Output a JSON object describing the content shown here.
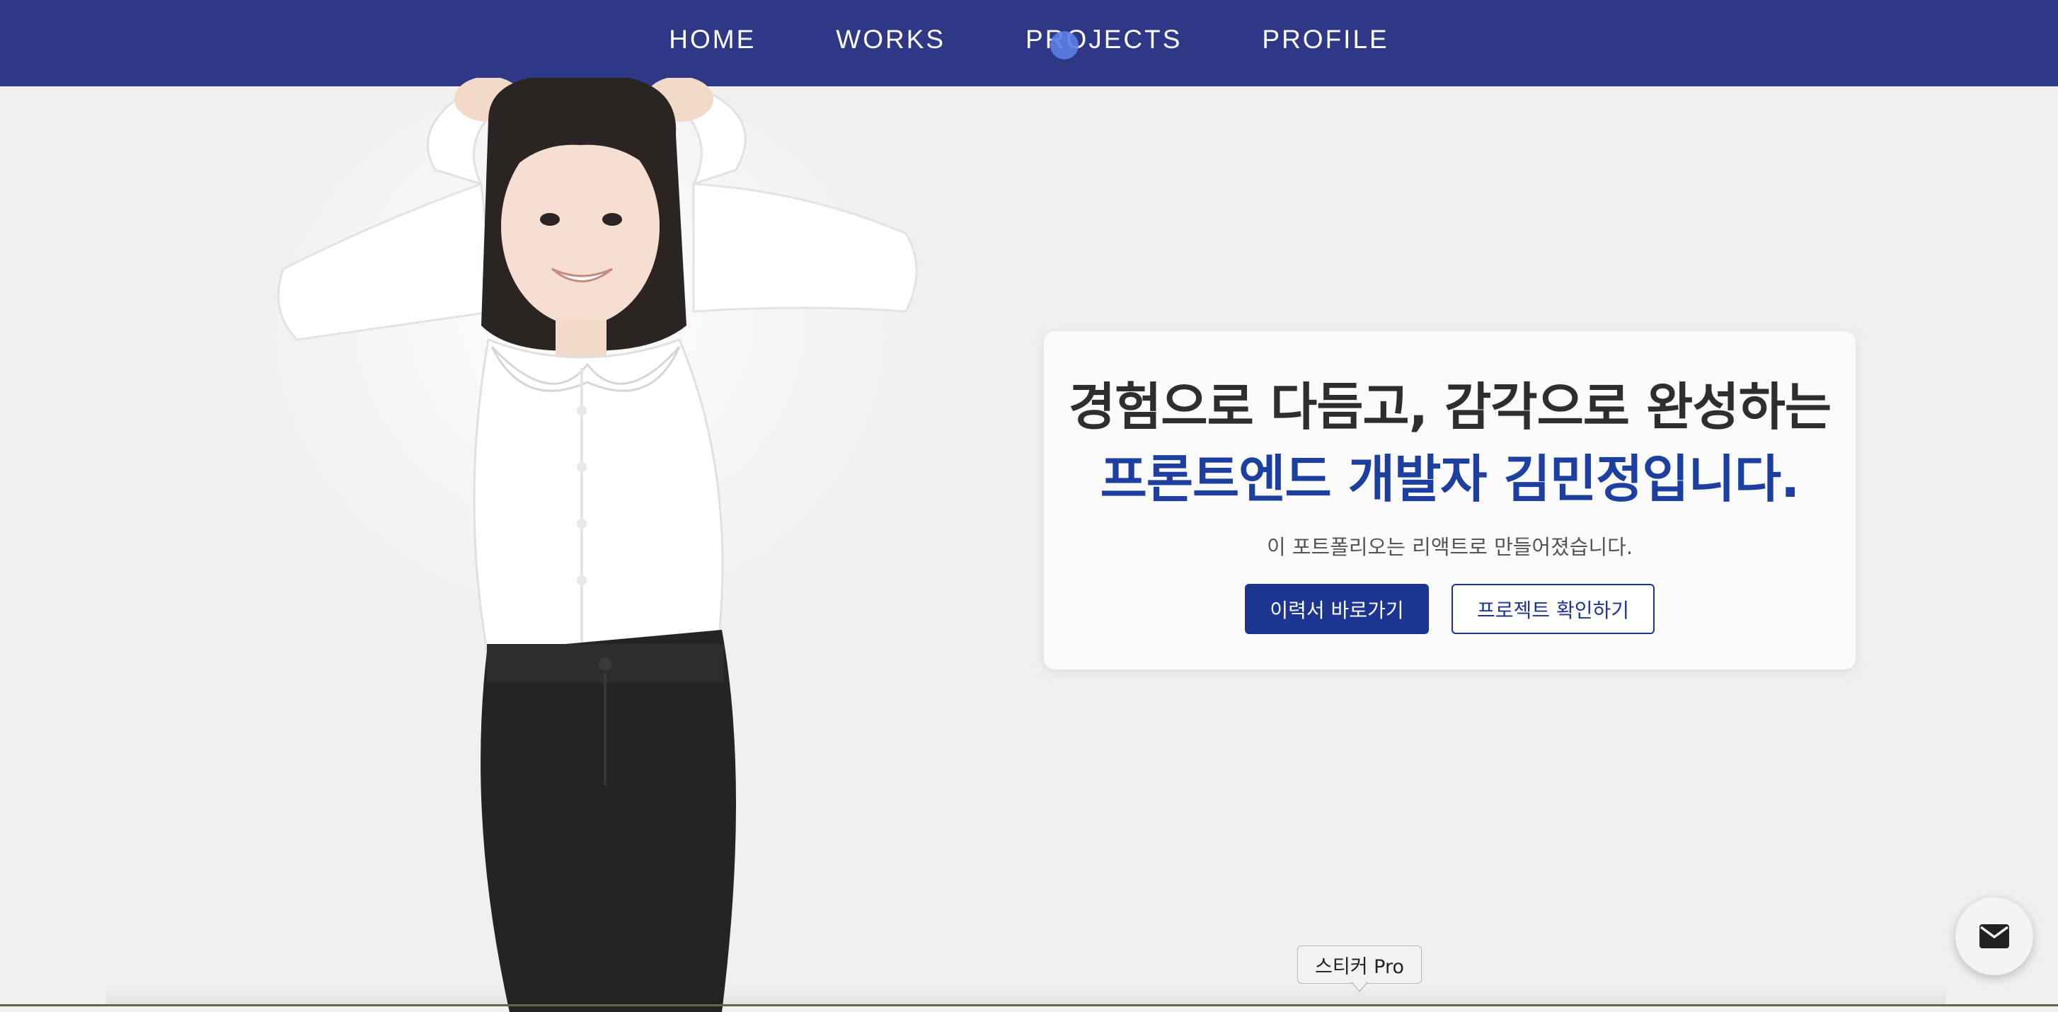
{
  "nav": {
    "items": [
      {
        "label": "HOME"
      },
      {
        "label": "WORKS"
      },
      {
        "label": "PROJECTS"
      },
      {
        "label": "PROFILE"
      }
    ]
  },
  "hero": {
    "headline_line1": "경험으로 다듬고, 감각으로 완성하는",
    "headline_line2": "프론트엔드 개발자 김민정입니다.",
    "subtitle": "이 포트폴리오는 리액트로 만들어졌습니다.",
    "primary_button": "이력서 바로가기",
    "secondary_button": "프로젝트 확인하기"
  },
  "tooltip": {
    "text": "스티커 Pro"
  },
  "colors": {
    "nav_bg": "#2f3787",
    "accent": "#1c3fa0",
    "button_primary": "#1c3591",
    "page_bg": "#f0f0f0"
  },
  "icons": {
    "mail": "mail-icon"
  }
}
